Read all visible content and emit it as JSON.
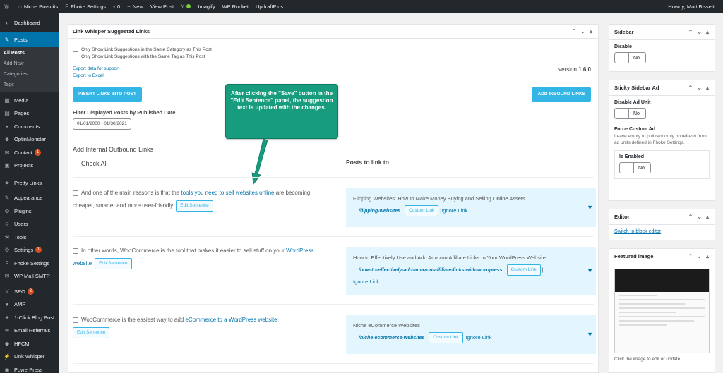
{
  "adminbar": {
    "wp_logo": "wordpress-icon",
    "items": [
      "Niche Pursuits",
      "Fhoke Settings",
      "0",
      "New",
      "View Post",
      "Imagify",
      "WP Rocket",
      "UpdraftPlus"
    ],
    "howdy": "Howdy, Matt Bissett"
  },
  "sidebar": {
    "dashboard": "Dashboard",
    "posts": "Posts",
    "sub": [
      "All Posts",
      "Add New",
      "Categories",
      "Tags"
    ],
    "items": [
      {
        "label": "Media",
        "icon": "media-icon"
      },
      {
        "label": "Pages",
        "icon": "pages-icon"
      },
      {
        "label": "Comments",
        "icon": "comments-icon"
      },
      {
        "label": "OptinMonster",
        "icon": "optinmonster-icon"
      },
      {
        "label": "Contact",
        "icon": "contact-icon",
        "badge": "1"
      },
      {
        "label": "Projects",
        "icon": "projects-icon"
      },
      {
        "label": "Pretty Links",
        "icon": "pretty-links-icon"
      },
      {
        "label": "Appearance",
        "icon": "appearance-icon"
      },
      {
        "label": "Plugins",
        "icon": "plugins-icon"
      },
      {
        "label": "Users",
        "icon": "users-icon"
      },
      {
        "label": "Tools",
        "icon": "tools-icon"
      },
      {
        "label": "Settings",
        "icon": "settings-icon",
        "badge": "1"
      },
      {
        "label": "Fhoke Settings",
        "icon": "fhoke-icon"
      },
      {
        "label": "WP Mail SMTP",
        "icon": "mail-icon"
      },
      {
        "label": "SEO",
        "icon": "seo-icon",
        "badge": "3"
      },
      {
        "label": "AMP",
        "icon": "amp-icon"
      },
      {
        "label": "1-Click Blog Post",
        "icon": "blog-post-icon"
      },
      {
        "label": "Email Referrals",
        "icon": "email-referrals-icon"
      },
      {
        "label": "HFCM",
        "icon": "hfcm-icon"
      },
      {
        "label": "Link Whisper",
        "icon": "link-whisper-icon"
      },
      {
        "label": "PowerPress",
        "icon": "powerpress-icon"
      }
    ]
  },
  "panel": {
    "title": "Link Whisper Suggested Links",
    "opt1": "Only Show Link Suggestions in the Same Category as This Post",
    "opt2": "Only Show Link Suggestions with the Same Tag as This Post",
    "version_label": "version",
    "version": "1.6.0",
    "export_support": "Export data for support",
    "export_excel": "Export to Excel",
    "insert_btn": "INSERT LINKS INTO POST",
    "inbound_btn": "ADD INBOUND LINKS",
    "filter_label": "Filter Displayed Posts by Published Date",
    "date_range": "01/01/2000 - 01/30/2021",
    "outbound_title": "Add Internal Outbound Links",
    "check_all": "Check All",
    "posts_to_link": "Posts to link to"
  },
  "callout": {
    "text": "After clicking the \"Save\" button in the \"Edit Sentence\" panel, the suggestion text is updated with the changes."
  },
  "suggestions": [
    {
      "pre": "And one of the main reasons is that the ",
      "link": "tools you need to sell websites online",
      "post": " are becoming cheaper, smarter and more user-friendly",
      "edit": "Edit Sentence",
      "target_title": "Flipping Websites: How to Make Money Buying and Selling Online Assets",
      "target_slug": "/flipping-websites",
      "custom": "Custom Link",
      "ignore": "Ignore Link"
    },
    {
      "pre": "In other words, WooCommerce is the tool that makes it easier to sell stuff on your ",
      "link": "WordPress website",
      "post": "",
      "edit": "Edit Sentence",
      "target_title": "How to Effectively Use and Add Amazon Affiliate Links to Your WordPress Website",
      "target_slug": "/how-to-effectively-add-amazon-affiliate-links-with-wordpress",
      "custom": "Custom Link",
      "ignore": "Ignore Link"
    },
    {
      "pre": "WooCommerce is the easiest way to add ",
      "link": "eCommerce to a WordPress website",
      "post": "",
      "edit": "Edit Sentence",
      "target_title": "Niche eCommerce Websites",
      "target_slug": "/niche-ecommerce-websites",
      "custom": "Custom Link",
      "ignore": "Ignore Link"
    }
  ],
  "right": {
    "sidebar_title": "Sidebar",
    "disable": "Disable",
    "no": "No",
    "sticky_title": "Sticky Sidebar Ad",
    "disable_ad": "Disable Ad Unit",
    "force_custom": "Force Custom Ad",
    "force_desc": "Leave empty to pull randomly on refresh from ad units defined in Fhoke Settings.",
    "is_enabled": "Is Enabled",
    "editor_title": "Editor",
    "switch_editor": "Switch to block editor",
    "featured_title": "Featured image",
    "featured_note": "Click the image to edit or update"
  }
}
